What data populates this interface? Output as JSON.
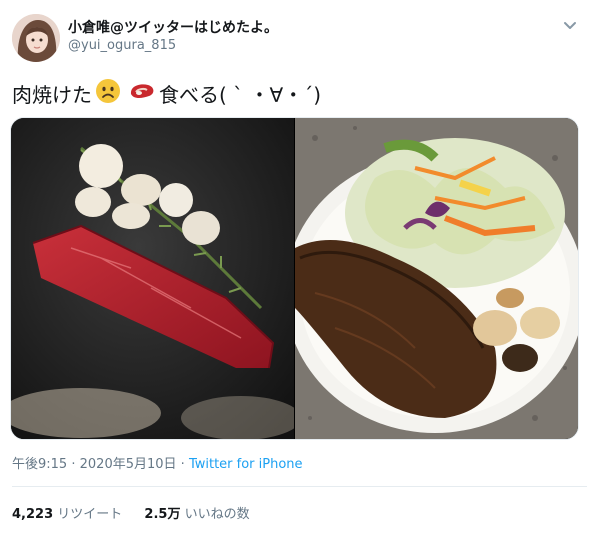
{
  "user": {
    "name": "小倉唯@ツイッターはじめたよ。",
    "handle": "@yui_ogura_815"
  },
  "tweet": {
    "text_part1": "肉焼けた",
    "text_part2": "食べる( ` ・∀・´)"
  },
  "meta": {
    "time": "午後9:15",
    "date": "2020年5月10日",
    "separator": "·",
    "source": "Twitter for iPhone"
  },
  "stats": {
    "retweets_count": "4,223",
    "retweets_label": "リツイート",
    "likes_count": "2.5万",
    "likes_label": "いいねの数"
  },
  "icons": [
    "chevron-down-icon",
    "worried-face-emoji",
    "meat-emoji"
  ],
  "colors": {
    "link": "#1da1f2",
    "secondary": "#657786",
    "text": "#14171a"
  }
}
